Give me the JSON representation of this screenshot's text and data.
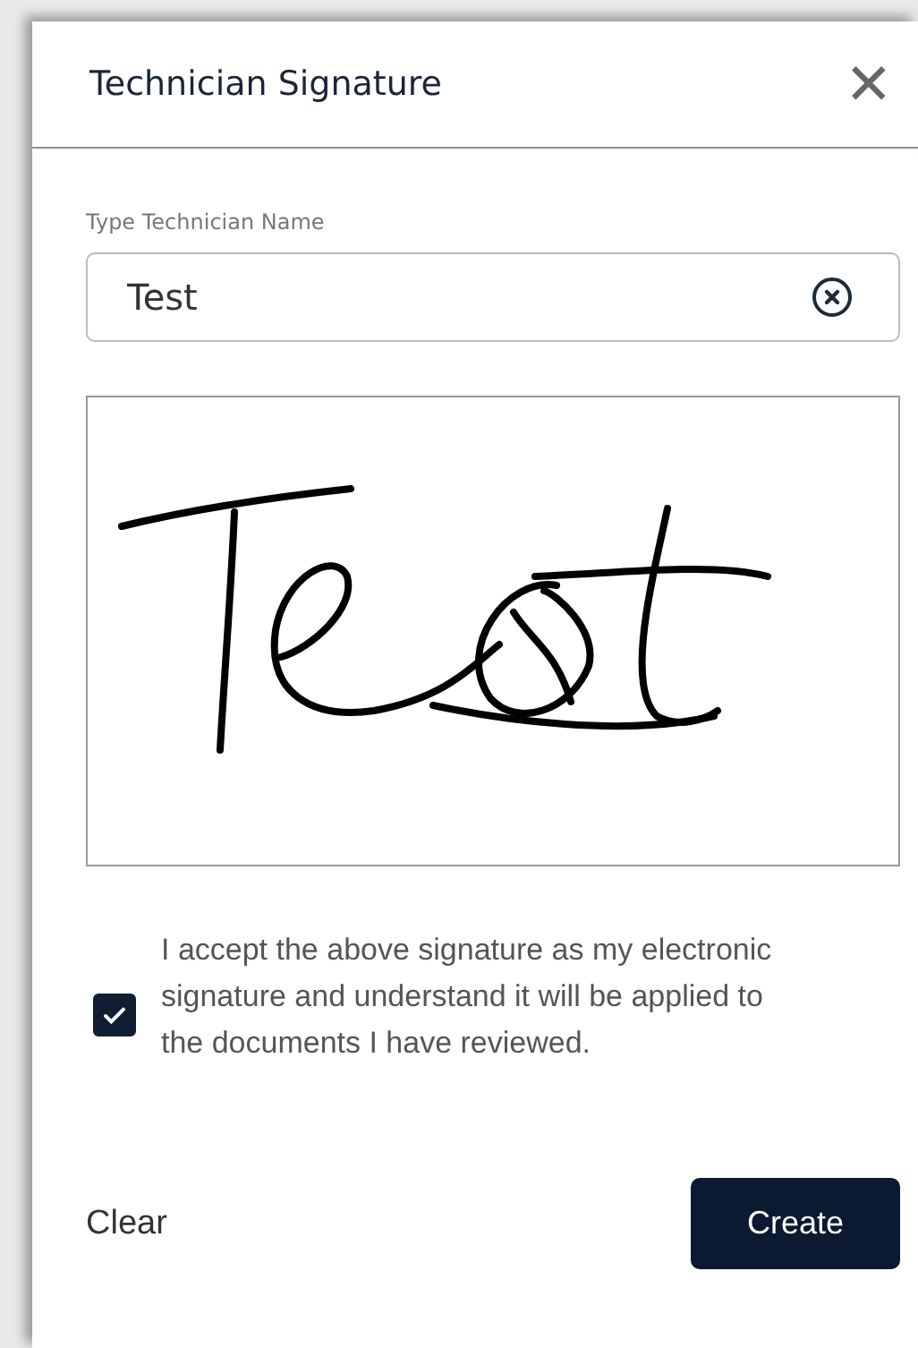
{
  "dialog": {
    "title": "Technician Signature",
    "close": "✕"
  },
  "name_field": {
    "label": "Type Technician Name",
    "value": "Test"
  },
  "signature_pad": {
    "kind": "drawn"
  },
  "consent": {
    "checked": true,
    "text": "I accept the above signature as my electronic signature and understand it will be applied to the documents I have reviewed."
  },
  "buttons": [
    {
      "label": "Clear",
      "kind": "link"
    },
    {
      "label": "Create",
      "kind": "primary"
    }
  ]
}
